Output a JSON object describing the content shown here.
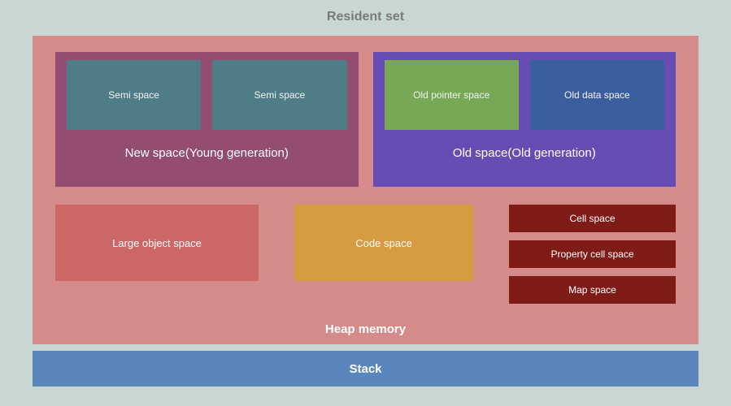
{
  "title": "Resident set",
  "heap": {
    "label": "Heap memory",
    "newSpace": {
      "title": "New space(Young generation)",
      "boxes": [
        "Semi space",
        "Semi space"
      ]
    },
    "oldSpace": {
      "title": "Old space(Old generation)",
      "boxes": [
        "Old pointer space",
        "Old data space"
      ]
    },
    "row2": {
      "largeObject": "Large object space",
      "codeSpace": "Code space",
      "rightCol": [
        "Cell space",
        "Property cell space",
        "Map space"
      ]
    }
  },
  "stack": "Stack"
}
